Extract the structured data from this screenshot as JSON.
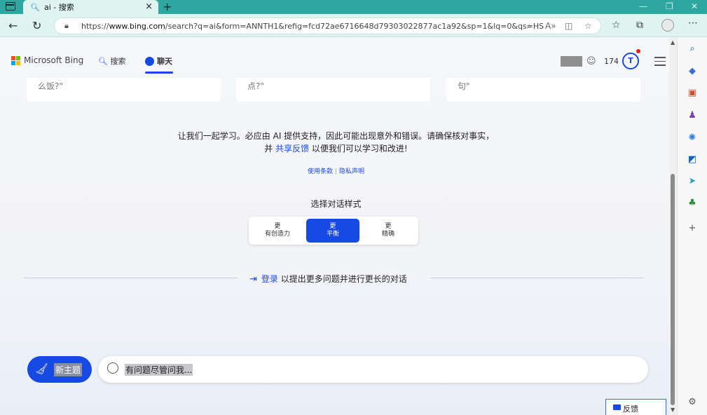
{
  "browser": {
    "tab_title": "ai - 搜索",
    "tab_close": "×",
    "new_tab": "+",
    "url_prefix": "https://",
    "url_host": "www.bing.com",
    "url_rest": "/search?q=ai&form=ANNTH1&refig=fcd72ae6716648d79303022877ac1a92&sp=1&lq=0&qs=HS&sc=...",
    "window_controls": [
      "—",
      "❐",
      "✕"
    ],
    "addr_icons": [
      "⌕",
      "A»",
      "◫",
      "☆"
    ],
    "toolbar_icons": [
      "☆",
      "⧉"
    ],
    "more": "⋯"
  },
  "header": {
    "brand": "Microsoft Bing",
    "tabs": [
      {
        "label": "搜索"
      },
      {
        "label": "聊天"
      }
    ],
    "points": "174",
    "trophy": "T"
  },
  "cards": [
    "么饭?\"",
    "点?\"",
    "句\""
  ],
  "disclaimer": {
    "line1": "让我们一起学习。必应由 AI 提供支持，因此可能出现意外和错误。请确保核对事实，",
    "line2_pre": "并 ",
    "line2_link": "共享反馈",
    "line2_post": " 以便我们可以学习和改进!"
  },
  "legal": {
    "terms": "使用条款",
    "privacy": "隐私声明",
    "sep": "|"
  },
  "style_selector": {
    "heading": "选择对话样式",
    "options": [
      {
        "top": "更",
        "bottom": "有创造力"
      },
      {
        "top": "更",
        "bottom": "平衡"
      },
      {
        "top": "更",
        "bottom": "精确"
      }
    ],
    "selected_index": 1
  },
  "signin": {
    "link": "登录",
    "text": " 以提出更多问题并进行更长的对话"
  },
  "composer": {
    "new_topic": "新主题",
    "placeholder": "有问题尽管问我..."
  },
  "feedback": "反馈",
  "colors": {
    "accent": "#174ae4",
    "tabstrip": "#2fa7a0"
  },
  "sidebar_icons": [
    "search-icon",
    "tag-icon",
    "toolbox-icon",
    "games-icon",
    "copilot-icon",
    "outlook-icon",
    "send-icon",
    "tree-icon",
    "add-icon",
    "settings-icon"
  ]
}
